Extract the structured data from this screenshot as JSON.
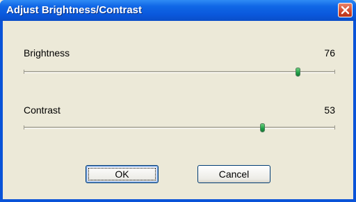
{
  "dialog": {
    "title": "Adjust Brightness/Contrast",
    "close_icon": "close-icon",
    "accent_color": "#0a53d8",
    "close_color": "#d1472b"
  },
  "brightness": {
    "label": "Brightness",
    "value": "76"
  },
  "contrast": {
    "label": "Contrast",
    "value": "53"
  },
  "buttons": {
    "ok": "OK",
    "cancel": "Cancel"
  }
}
